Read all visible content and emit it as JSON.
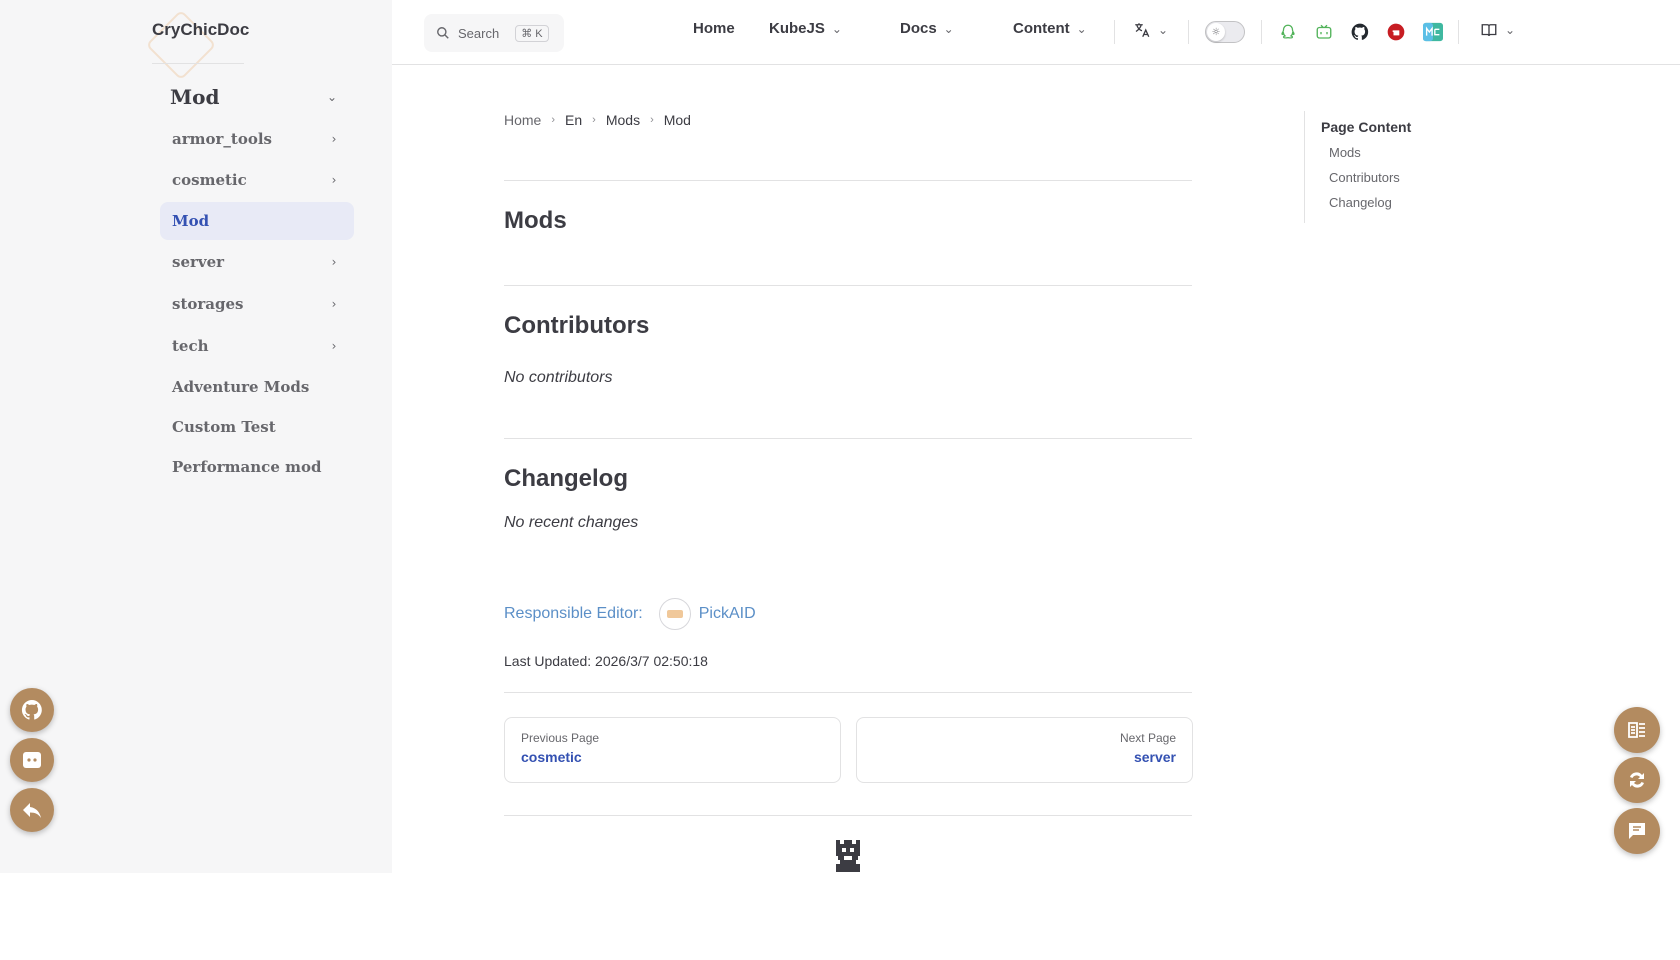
{
  "brand": {
    "name": "CryChicDoc"
  },
  "sidebar": {
    "root": {
      "label": "Mod",
      "icon": "chevron-down-icon"
    },
    "items": [
      {
        "label": "armor_tools",
        "icon": "chevron-right-icon"
      },
      {
        "label": "cosmetic",
        "icon": "chevron-right-icon"
      },
      {
        "label": "Mod",
        "active": true
      },
      {
        "label": "server",
        "icon": "chevron-right-icon"
      },
      {
        "label": "storages",
        "icon": "chevron-right-icon"
      },
      {
        "label": "tech",
        "icon": "chevron-right-icon"
      },
      {
        "label": "Adventure Mods"
      },
      {
        "label": "Custom Test"
      },
      {
        "label": "Performance mod"
      }
    ],
    "floating_buttons": [
      "github-icon",
      "discord-icon",
      "back-arrow-icon"
    ]
  },
  "topbar": {
    "search": {
      "label": "Search",
      "shortcut": "⌘ K"
    },
    "nav": [
      {
        "label": "Home"
      },
      {
        "label": "KubeJS",
        "dropdown": true
      },
      {
        "label": "Docs",
        "dropdown": true
      },
      {
        "label": "Content",
        "dropdown": true
      }
    ],
    "language_icon": "translate-icon",
    "theme_toggle_icon": "sun-icon",
    "social_icons": [
      "qq-icon",
      "bilibili-icon",
      "github-icon",
      "gitee-icon",
      "mcmod-icon"
    ],
    "extra_icon": "book-icon"
  },
  "breadcrumb": [
    "Home",
    "En",
    "Mods",
    "Mod"
  ],
  "content": {
    "sections": [
      {
        "heading": "Mods",
        "body": ""
      },
      {
        "heading": "Contributors",
        "body": "No contributors"
      },
      {
        "heading": "Changelog",
        "body": "No recent changes"
      }
    ],
    "editor_label": "Responsible Editor:",
    "editor_name": "PickAID",
    "last_updated": "Last Updated: 2026/3/7 02:50:18"
  },
  "pager": {
    "prev": {
      "desc": "Previous Page",
      "title": "cosmetic"
    },
    "next": {
      "desc": "Next Page",
      "title": "server"
    }
  },
  "toc": {
    "title": "Page Content",
    "links": [
      "Mods",
      "Contributors",
      "Changelog"
    ]
  },
  "right_floating_buttons": [
    "outline-icon",
    "refresh-icon",
    "comment-icon"
  ],
  "colors": {
    "accent": "#3451b2",
    "link": "#5b8fc7",
    "fab": "#b38b60",
    "sidebar_bg": "#f6f6f7"
  }
}
